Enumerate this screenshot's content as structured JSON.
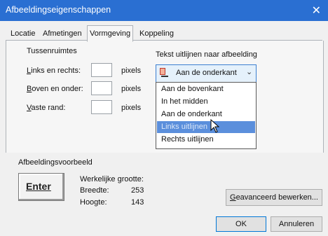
{
  "window": {
    "title": "Afbeeldingseigenschappen",
    "close_glyph": "✕"
  },
  "tabs": [
    {
      "label": "Locatie"
    },
    {
      "label": "Afmetingen"
    },
    {
      "label": "Vormgeving"
    },
    {
      "label": "Koppeling"
    }
  ],
  "active_tab": "Vormgeving",
  "spacing": {
    "group_title": "Tussenruimtes",
    "rows": [
      {
        "label_u": "L",
        "label_rest": "inks en rechts:",
        "value": "",
        "unit": "pixels"
      },
      {
        "label_u": "B",
        "label_rest": "oven en onder:",
        "value": "",
        "unit": "pixels"
      },
      {
        "label_u": "V",
        "label_rest": "aste rand:",
        "value": "",
        "unit": "pixels"
      }
    ]
  },
  "align": {
    "group_title": "Tekst uitlijnen naar afbeelding",
    "selected_value": "Aan de onderkant",
    "options": [
      "Aan de bovenkant",
      "In het midden",
      "Aan de onderkant",
      "Links uitlijnen",
      "Rechts uitlijnen"
    ],
    "highlighted_index": 3
  },
  "preview": {
    "group_title": "Afbeeldingsvoorbeeld",
    "button_label": "Enter",
    "actual_size_label": "Werkelijke grootte:",
    "width_label": "Breedte:",
    "width_value": "253",
    "height_label": "Hoogte:",
    "height_value": "143",
    "advanced_u": "G",
    "advanced_rest": "eavanceerd bewerken..."
  },
  "footer": {
    "ok_label": "OK",
    "cancel_label": "Annuleren"
  },
  "colors": {
    "titlebar": "#2a6fd2",
    "highlight": "#5b8fdc",
    "focus_border": "#0078d7"
  }
}
